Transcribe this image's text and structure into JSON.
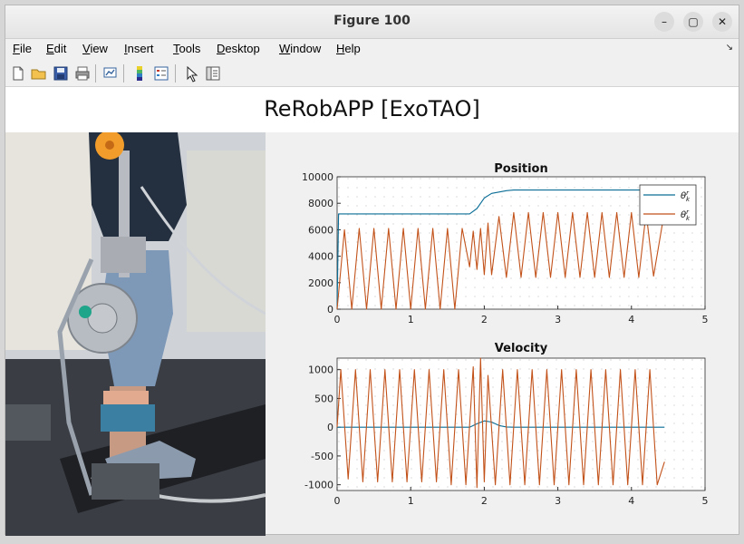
{
  "window": {
    "title": "Figure 100"
  },
  "window_controls": {
    "minimize": "–",
    "maximize": "▢",
    "close": "✕"
  },
  "menu": [
    {
      "key": "F",
      "rest": "ile"
    },
    {
      "key": "E",
      "rest": "dit"
    },
    {
      "key": "V",
      "rest": "iew"
    },
    {
      "key": "I",
      "rest": "nsert"
    },
    {
      "key": "T",
      "rest": "ools"
    },
    {
      "key": "D",
      "rest": "esktop"
    },
    {
      "key": "W",
      "rest": "indow"
    },
    {
      "key": "H",
      "rest": "elp"
    }
  ],
  "toolbar_icons": [
    "new-figure-icon",
    "open-folder-icon",
    "save-icon",
    "print-icon",
    "link-plot-icon",
    "colorbar-icon",
    "legend-icon",
    "pointer-icon",
    "property-editor-icon"
  ],
  "app": {
    "title": "ReRobAPP [ExoTAO]"
  },
  "photo": {
    "description_icon": "exoskeleton-photo"
  },
  "colors": {
    "blue": "#0a6d96",
    "orange": "#c2521a"
  },
  "chart_data": [
    {
      "type": "line",
      "title": "Position",
      "xlim": [
        0,
        5
      ],
      "ylim": [
        0,
        10000
      ],
      "xticks": [
        0,
        1,
        2,
        3,
        4,
        5
      ],
      "yticks": [
        0,
        2000,
        4000,
        6000,
        8000,
        10000
      ],
      "grid": "minor-dotted",
      "legend": {
        "placement": "top-right",
        "entries": [
          "θ_k^r",
          "θ_k^r"
        ]
      },
      "series": [
        {
          "color": "#0a6d96",
          "x": [
            0,
            0.02,
            0.05,
            1.8,
            1.9,
            2.0,
            2.1,
            2.3,
            2.4,
            4.45
          ],
          "y": [
            0,
            7200,
            7200,
            7200,
            7600,
            8400,
            8750,
            8950,
            9000,
            9000
          ]
        },
        {
          "color": "#c2521a",
          "x": [
            0,
            0.1,
            0.2,
            0.3,
            0.4,
            0.5,
            0.6,
            0.7,
            0.8,
            0.9,
            1.0,
            1.1,
            1.2,
            1.3,
            1.4,
            1.5,
            1.6,
            1.7,
            1.8,
            1.85,
            1.9,
            1.95,
            2.0,
            2.05,
            2.1,
            2.2,
            2.3,
            2.4,
            2.5,
            2.6,
            2.7,
            2.8,
            2.9,
            3.0,
            3.1,
            3.2,
            3.3,
            3.4,
            3.5,
            3.6,
            3.7,
            3.8,
            3.9,
            4.0,
            4.1,
            4.2,
            4.3,
            4.45
          ],
          "y": [
            0,
            6000,
            0,
            6100,
            0,
            6100,
            0,
            6100,
            0,
            6100,
            0,
            6100,
            0,
            6100,
            0,
            6100,
            0,
            6100,
            3200,
            5900,
            3000,
            6100,
            2600,
            6500,
            2600,
            7000,
            2400,
            7300,
            2400,
            7300,
            2400,
            7300,
            2400,
            7300,
            2400,
            7300,
            2400,
            7300,
            2400,
            7300,
            2400,
            7300,
            2400,
            7300,
            2400,
            7300,
            2500,
            7400
          ]
        }
      ]
    },
    {
      "type": "line",
      "title": "Velocity",
      "xlim": [
        0,
        5
      ],
      "ylim": [
        -1100,
        1200
      ],
      "xticks": [
        0,
        1,
        2,
        3,
        4,
        5
      ],
      "yticks": [
        -1000,
        -500,
        0,
        500,
        1000
      ],
      "grid": "minor-dotted",
      "series": [
        {
          "color": "#0a6d96",
          "x": [
            0,
            1.8,
            1.9,
            2.0,
            2.1,
            2.2,
            2.3,
            2.4,
            4.45
          ],
          "y": [
            0,
            0,
            60,
            110,
            90,
            30,
            5,
            0,
            0
          ]
        },
        {
          "color": "#c2521a",
          "x": [
            0,
            0.05,
            0.15,
            0.25,
            0.35,
            0.45,
            0.55,
            0.65,
            0.75,
            0.85,
            0.95,
            1.05,
            1.15,
            1.25,
            1.35,
            1.45,
            1.55,
            1.65,
            1.75,
            1.85,
            1.9,
            1.95,
            2.0,
            2.05,
            2.15,
            2.25,
            2.35,
            2.45,
            2.55,
            2.65,
            2.75,
            2.85,
            2.95,
            3.05,
            3.15,
            3.25,
            3.35,
            3.45,
            3.55,
            3.65,
            3.75,
            3.85,
            3.95,
            4.05,
            4.15,
            4.25,
            4.35,
            4.45
          ],
          "y": [
            0,
            1000,
            -900,
            1000,
            -950,
            1000,
            -950,
            1000,
            -950,
            1000,
            -950,
            1000,
            -950,
            1000,
            -950,
            1000,
            -1000,
            1000,
            -1000,
            1050,
            -1050,
            1200,
            -950,
            900,
            -1000,
            1000,
            -1000,
            1000,
            -1000,
            1000,
            -1000,
            1000,
            -1000,
            1000,
            -1000,
            1000,
            -1000,
            1000,
            -1000,
            1000,
            -1000,
            1000,
            -1000,
            1000,
            -1000,
            1000,
            -1000,
            -600
          ]
        }
      ]
    }
  ]
}
